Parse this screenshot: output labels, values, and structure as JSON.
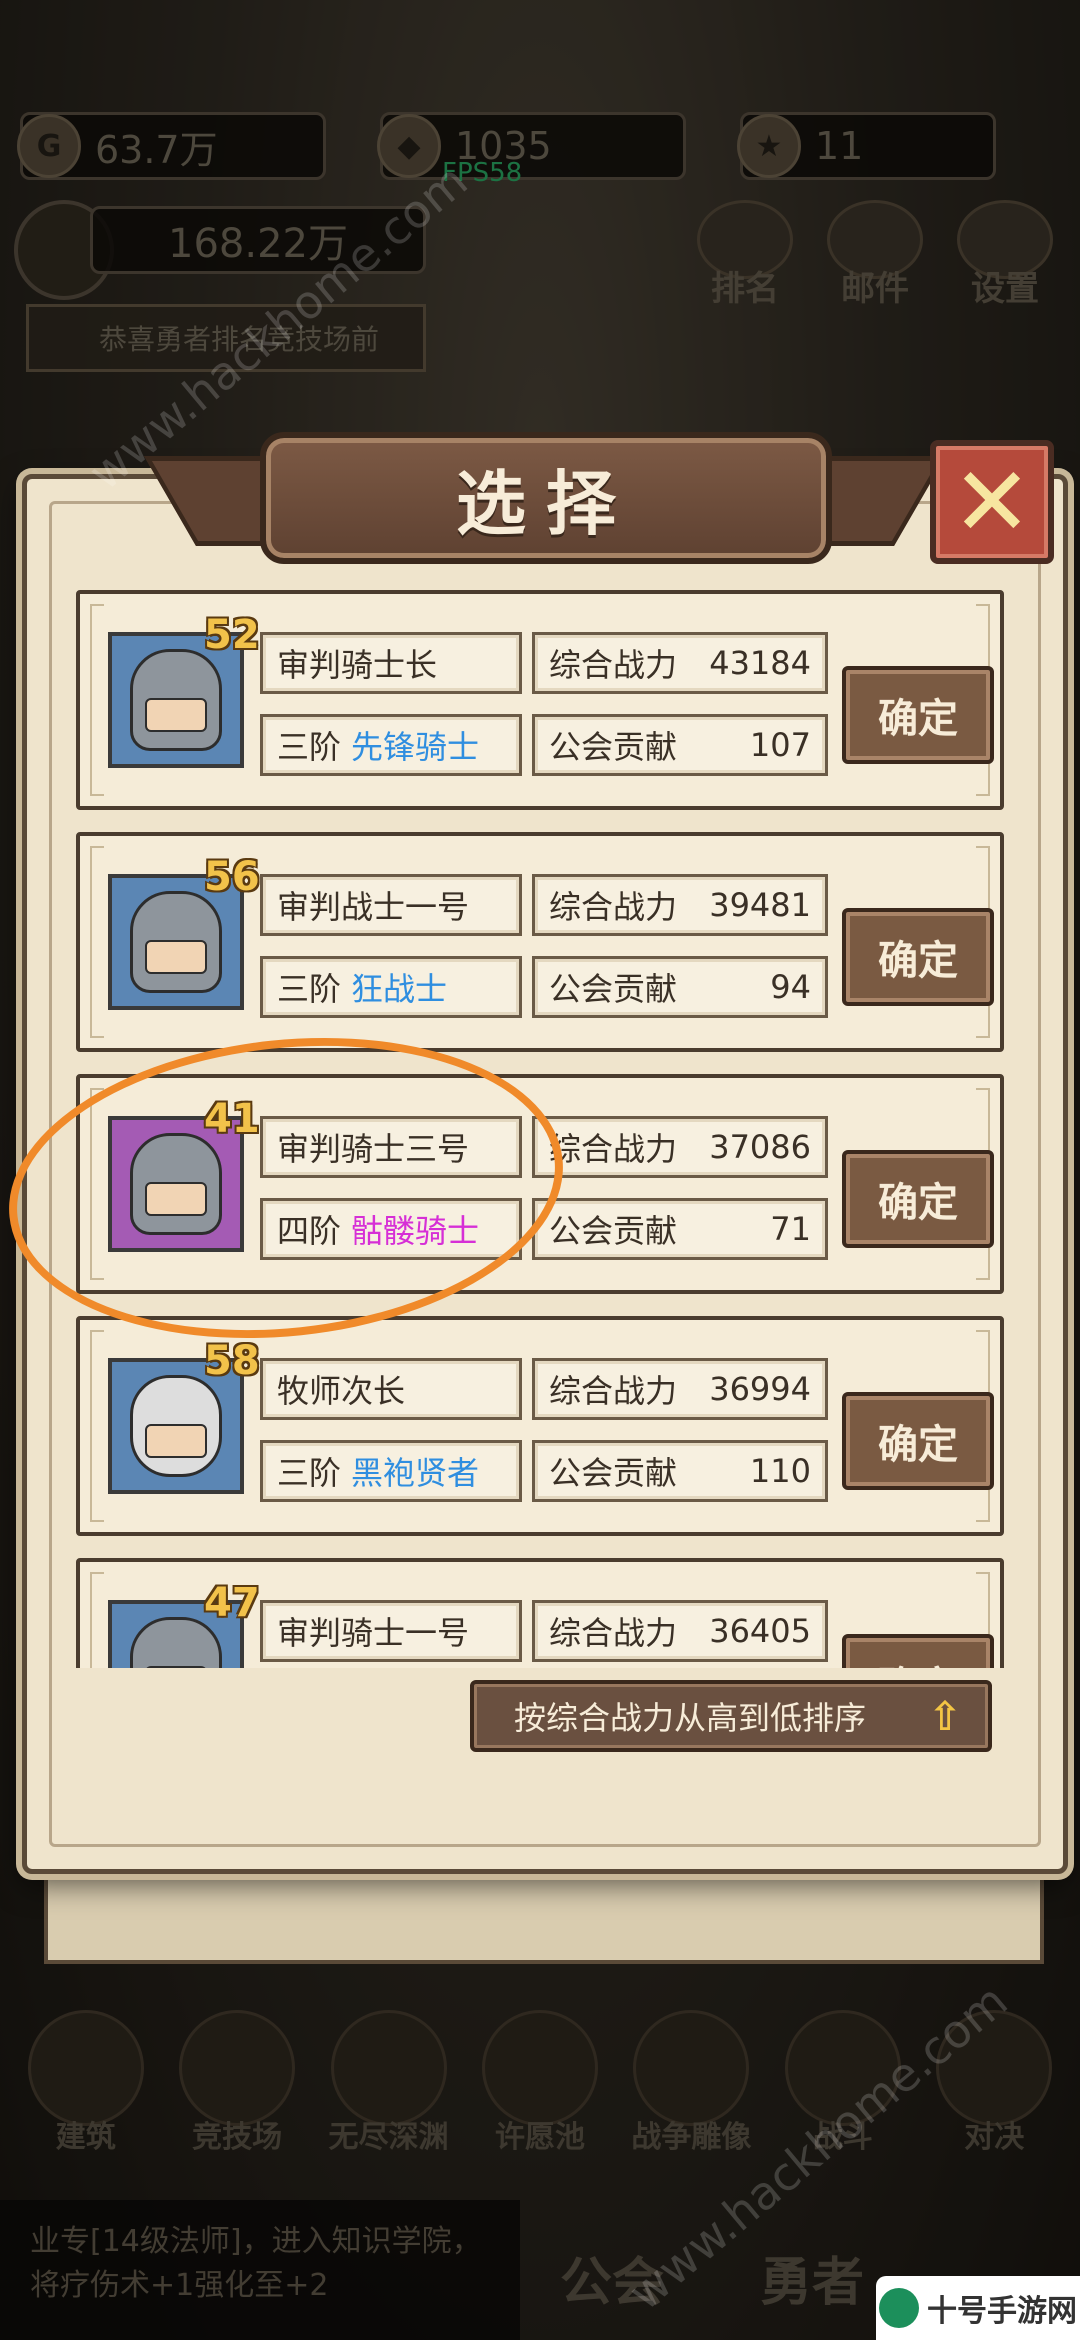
{
  "hud": {
    "gold": "63.7万",
    "gems": "1035",
    "fps": "FPS58",
    "tokens": "11",
    "power": "168.22万",
    "notice": "恭喜勇者排名竞技场前",
    "rank_btn": "排名",
    "mail_btn": "邮件",
    "settings_btn": "设置"
  },
  "modal": {
    "title": "选择",
    "close": "✕",
    "sort_label": "按综合战力从高到低排序",
    "sort_arrow": "⇧"
  },
  "labels": {
    "power": "综合战力",
    "contribution": "公会贡献",
    "confirm": "确定"
  },
  "heroes": [
    {
      "level": "52",
      "name": "审判骑士长",
      "tier": "三阶",
      "cls": "先锋骑士",
      "power": "43184",
      "contribution": "107",
      "frame": "blue",
      "cls_color": "blue"
    },
    {
      "level": "56",
      "name": "审判战士一号",
      "tier": "三阶",
      "cls": "狂战士",
      "power": "39481",
      "contribution": "94",
      "frame": "blue",
      "cls_color": "blue"
    },
    {
      "level": "41",
      "name": "审判骑士三号",
      "tier": "四阶",
      "cls": "骷髅骑士",
      "power": "37086",
      "contribution": "71",
      "frame": "purple",
      "cls_color": "purple"
    },
    {
      "level": "58",
      "name": "牧师次长",
      "tier": "三阶",
      "cls": "黑袍贤者",
      "power": "36994",
      "contribution": "110",
      "frame": "blue",
      "cls_color": "blue"
    },
    {
      "level": "47",
      "name": "审判骑士一号",
      "tier": "",
      "cls": "",
      "power": "36405",
      "contribution": "",
      "frame": "blue",
      "cls_color": "blue"
    }
  ],
  "bottom_nav": [
    "建筑",
    "竞技场",
    "无尽深渊",
    "许愿池",
    "战争雕像",
    "战斗",
    "对决"
  ],
  "bottom_tabs": [
    "公会",
    "勇者"
  ],
  "footer": "业专[14级法师]，进入知识学院，将疗伤术+1强化至+2",
  "watermark": "www.hackhome.com",
  "brand": "十号手游网",
  "colors": {
    "annotation": "#f08a2a",
    "class_blue": "#2f8ee0",
    "class_purple": "#d62fd6"
  }
}
